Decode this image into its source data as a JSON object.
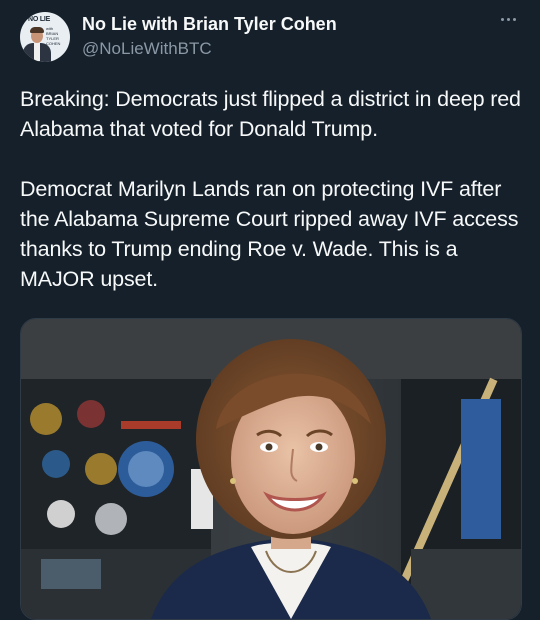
{
  "author": {
    "display_name": "No Lie with Brian Tyler Cohen",
    "handle": "@NoLieWithBTC",
    "avatar": {
      "logo_text": "NO LIE",
      "logo_subtext": "with BRIAN TYLER COHEN"
    }
  },
  "tweet": {
    "paragraphs": [
      "Breaking: Democrats just flipped a district in deep red Alabama that voted for Donald Trump.",
      "Democrat Marilyn Lands ran on protecting IVF after the Alabama Supreme Court ripped away IVF access thanks to Trump ending Roe v. Wade. This is a MAJOR upset."
    ]
  },
  "icons": {
    "more": "more-horizontal-icon"
  },
  "colors": {
    "background": "#15202b",
    "text_primary": "#f7f9f9",
    "text_secondary": "#8b98a5"
  }
}
